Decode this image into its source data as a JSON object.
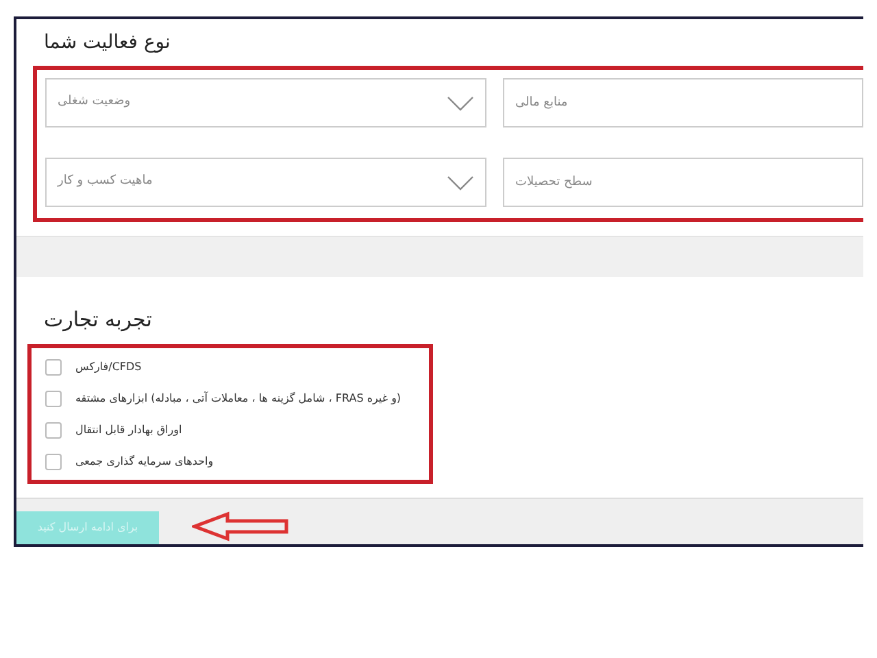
{
  "activity": {
    "title": "نوع فعالیت شما",
    "fields": [
      {
        "kind": "input",
        "placeholder": "منابع مالی"
      },
      {
        "kind": "select",
        "placeholder": "وضعیت شغلی"
      },
      {
        "kind": "input",
        "placeholder": "سطح تحصیلات"
      },
      {
        "kind": "select",
        "placeholder": "ماهیت کسب و کار"
      }
    ]
  },
  "experience": {
    "title": "تجربه تجارت",
    "options": [
      {
        "label": "CFDS/فارکس",
        "checked": false
      },
      {
        "label": "(و غیره FRAS ، شامل گزینه ها ، معاملات آتی ، مبادله) ابزارهای مشتقه",
        "checked": false
      },
      {
        "label": "اوراق بهادار قابل انتقال",
        "checked": false
      },
      {
        "label": "واحدهای سرمایه گذاری جمعی",
        "checked": false
      }
    ]
  },
  "submit": {
    "label": "برای ادامه ارسال کنید"
  }
}
